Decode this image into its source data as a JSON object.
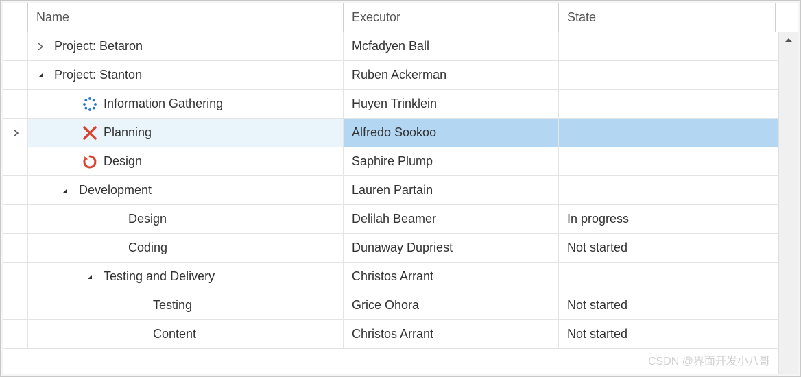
{
  "columns": {
    "name": "Name",
    "executor": "Executor",
    "state": "State"
  },
  "rows": [
    {
      "level": 0,
      "expander": "collapsed",
      "icon": null,
      "name": "Project: Betaron",
      "executor": "Mcfadyen Ball",
      "state": "",
      "selected": false,
      "indicator": false
    },
    {
      "level": 0,
      "expander": "expanded",
      "icon": null,
      "name": "Project: Stanton",
      "executor": "Ruben Ackerman",
      "state": "",
      "selected": false,
      "indicator": false
    },
    {
      "level": 1,
      "expander": null,
      "icon": "progress-dots",
      "name": "Information Gathering",
      "executor": "Huyen Trinklein",
      "state": "",
      "selected": false,
      "indicator": false
    },
    {
      "level": 1,
      "expander": null,
      "icon": "x-red",
      "name": "Planning",
      "executor": "Alfredo Sookoo",
      "state": "",
      "selected": true,
      "indicator": true
    },
    {
      "level": 1,
      "expander": null,
      "icon": "refresh",
      "name": "Design",
      "executor": "Saphire Plump",
      "state": "",
      "selected": false,
      "indicator": false
    },
    {
      "level": 1,
      "expander": "expanded",
      "icon": null,
      "name": "Development",
      "executor": "Lauren Partain",
      "state": "",
      "selected": false,
      "indicator": false
    },
    {
      "level": 2,
      "expander": null,
      "icon": null,
      "name": "Design",
      "executor": "Delilah Beamer",
      "state": "In progress",
      "selected": false,
      "indicator": false
    },
    {
      "level": 2,
      "expander": null,
      "icon": null,
      "name": "Coding",
      "executor": "Dunaway Dupriest",
      "state": "Not started",
      "selected": false,
      "indicator": false
    },
    {
      "level": 2,
      "expander": "expanded",
      "icon": null,
      "name": "Testing and Delivery",
      "executor": "Christos Arrant",
      "state": "",
      "selected": false,
      "indicator": false
    },
    {
      "level": 3,
      "expander": null,
      "icon": null,
      "name": "Testing",
      "executor": "Grice Ohora",
      "state": "Not started",
      "selected": false,
      "indicator": false
    },
    {
      "level": 3,
      "expander": null,
      "icon": null,
      "name": "Content",
      "executor": "Christos Arrant",
      "state": "Not started",
      "selected": false,
      "indicator": false
    }
  ],
  "watermark": "CSDN @界面开发小八哥",
  "icons": {
    "expand_collapsed": "chevron-right-icon",
    "expand_expanded": "chevron-down-filled-icon"
  }
}
